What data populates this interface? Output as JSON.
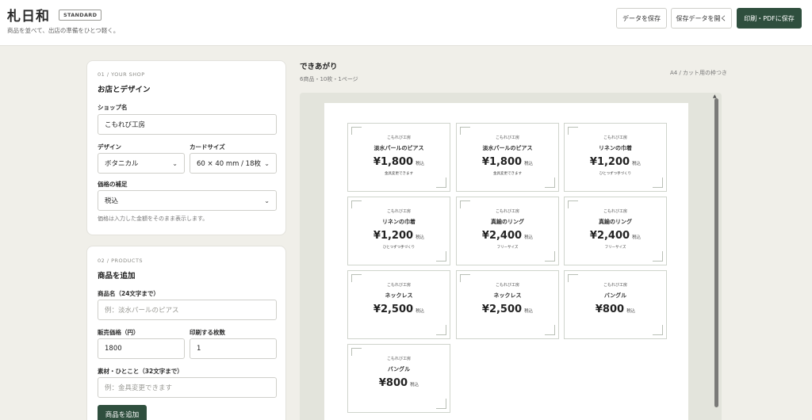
{
  "header": {
    "logo": "札日和",
    "badge": "STANDARD",
    "tagline": "商品を並べて、出店の準備をひとつ軽く。",
    "buttons": {
      "save": "データを保存",
      "open": "保存データを開く",
      "print": "印刷・PDFに保存"
    }
  },
  "shop_panel": {
    "step": "01 / YOUR SHOP",
    "title": "お店とデザイン",
    "shop_name_label": "ショップ名",
    "shop_name_value": "こもれび工房",
    "design_label": "デザイン",
    "design_value": "ボタニカル",
    "card_size_label": "カードサイズ",
    "card_size_value": "60 × 40 mm / 18枚",
    "price_note_label": "価格の補足",
    "price_note_value": "税込",
    "hint": "価格は入力した金額をそのまま表示します。"
  },
  "product_panel": {
    "step": "02 / PRODUCTS",
    "title": "商品を追加",
    "name_label": "商品名（24文字まで）",
    "name_placeholder": "例：淡水パールのピアス",
    "price_label": "販売価格（円）",
    "price_value": "1800",
    "count_label": "印刷する枚数",
    "count_value": "1",
    "material_label": "素材・ひとこと（32文字まで）",
    "material_placeholder": "例：金具変更できます",
    "add_button": "商品を追加"
  },
  "preview": {
    "title": "できあがり",
    "summary": "6商品・10枚・1ページ",
    "note": "A4 / カット用の枠つき"
  },
  "cards": [
    {
      "shop": "こもれび工房",
      "name": "淡水パールのピアス",
      "price": "¥1,800",
      "tax": "税込",
      "note": "金具変更できます"
    },
    {
      "shop": "こもれび工房",
      "name": "淡水パールのピアス",
      "price": "¥1,800",
      "tax": "税込",
      "note": "金具変更できます"
    },
    {
      "shop": "こもれび工房",
      "name": "リネンの巾着",
      "price": "¥1,200",
      "tax": "税込",
      "note": "ひとつずつ手づくり"
    },
    {
      "shop": "こもれび工房",
      "name": "リネンの巾着",
      "price": "¥1,200",
      "tax": "税込",
      "note": "ひとつずつ手づくり"
    },
    {
      "shop": "こもれび工房",
      "name": "真鍮のリング",
      "price": "¥2,400",
      "tax": "税込",
      "note": "フリーサイズ"
    },
    {
      "shop": "こもれび工房",
      "name": "真鍮のリング",
      "price": "¥2,400",
      "tax": "税込",
      "note": "フリーサイズ"
    },
    {
      "shop": "こもれび工房",
      "name": "ネックレス",
      "price": "¥2,500",
      "tax": "税込",
      "note": ""
    },
    {
      "shop": "こもれび工房",
      "name": "ネックレス",
      "price": "¥2,500",
      "tax": "税込",
      "note": ""
    },
    {
      "shop": "こもれび工房",
      "name": "バングル",
      "price": "¥800",
      "tax": "税込",
      "note": ""
    },
    {
      "shop": "こもれび工房",
      "name": "バングル",
      "price": "¥800",
      "tax": "税込",
      "note": ""
    }
  ],
  "colors": {
    "accent": "#2f4f3e",
    "background": "#f0efe9",
    "preview_bg": "#e3e4dc"
  }
}
